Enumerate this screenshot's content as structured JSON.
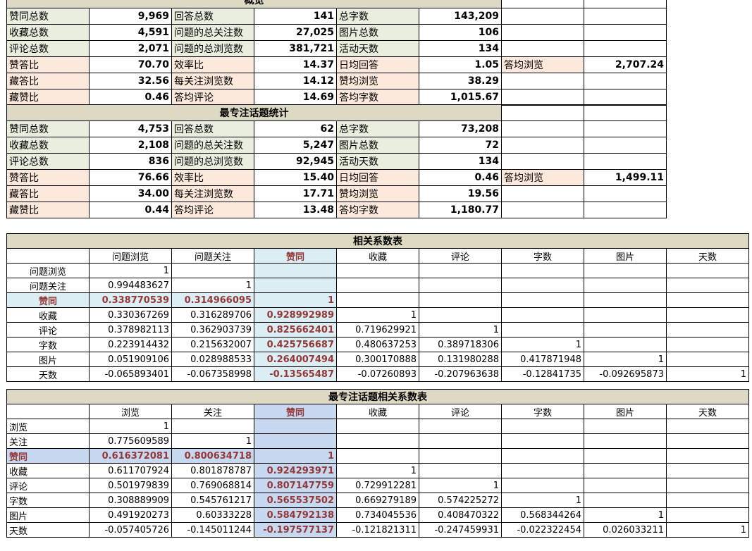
{
  "summary_overall": {
    "header": "概览",
    "rows": [
      {
        "c": [
          "green",
          "green",
          "green"
        ],
        "cells": [
          [
            "赞同总数",
            "9,969"
          ],
          [
            "回答总数",
            "141"
          ],
          [
            "总字数",
            "143,209"
          ]
        ]
      },
      {
        "c": [
          "green",
          "green",
          "green"
        ],
        "cells": [
          [
            "收藏总数",
            "4,591"
          ],
          [
            "问题的总关注数",
            "27,025"
          ],
          [
            "图片总数",
            "106"
          ]
        ]
      },
      {
        "c": [
          "green",
          "green",
          "green"
        ],
        "cells": [
          [
            "评论总数",
            "2,071"
          ],
          [
            "问题的总浏览数",
            "381,721"
          ],
          [
            "活动天数",
            "134"
          ]
        ]
      },
      {
        "c": [
          "pink",
          "pink",
          "pink"
        ],
        "cells": [
          [
            "赞答比",
            "70.70"
          ],
          [
            "效率比",
            "14.37"
          ],
          [
            "日均回答",
            "1.05"
          ]
        ],
        "extra": [
          "答均浏览",
          "2,707.24"
        ]
      },
      {
        "c": [
          "pink",
          "pink",
          "pink"
        ],
        "cells": [
          [
            "藏答比",
            "32.56"
          ],
          [
            "每关注浏览数",
            "14.12"
          ],
          [
            "赞均浏览",
            "38.29"
          ]
        ]
      },
      {
        "c": [
          "pink",
          "pink",
          "pink"
        ],
        "cells": [
          [
            "藏赞比",
            "0.46"
          ],
          [
            "答均评论",
            "14.69"
          ],
          [
            "答均字数",
            "1,015.67"
          ]
        ]
      }
    ]
  },
  "summary_focus": {
    "header": "最专注话题统计",
    "rows": [
      {
        "c": [
          "green",
          "green",
          "green"
        ],
        "cells": [
          [
            "赞同总数",
            "4,753"
          ],
          [
            "回答总数",
            "62"
          ],
          [
            "总字数",
            "73,208"
          ]
        ]
      },
      {
        "c": [
          "green",
          "green",
          "green"
        ],
        "cells": [
          [
            "收藏总数",
            "2,108"
          ],
          [
            "问题的总关注数",
            "5,247"
          ],
          [
            "图片总数",
            "72"
          ]
        ]
      },
      {
        "c": [
          "green",
          "green",
          "green"
        ],
        "cells": [
          [
            "评论总数",
            "836"
          ],
          [
            "问题的总浏览数",
            "92,945"
          ],
          [
            "活动天数",
            "134"
          ]
        ]
      },
      {
        "c": [
          "pink",
          "pink",
          "pink"
        ],
        "cells": [
          [
            "赞答比",
            "76.66"
          ],
          [
            "效率比",
            "15.40"
          ],
          [
            "日均回答",
            "0.46"
          ]
        ],
        "extra": [
          "答均浏览",
          "1,499.11"
        ]
      },
      {
        "c": [
          "pink",
          "pink",
          "pink"
        ],
        "cells": [
          [
            "藏答比",
            "34.00"
          ],
          [
            "每关注浏览数",
            "17.71"
          ],
          [
            "赞均浏览",
            "19.56"
          ]
        ]
      },
      {
        "c": [
          "pink",
          "pink",
          "pink"
        ],
        "cells": [
          [
            "藏赞比",
            "0.44"
          ],
          [
            "答均评论",
            "13.48"
          ],
          [
            "答均字数",
            "1,180.77"
          ]
        ]
      }
    ]
  },
  "corr_overall": {
    "title": "相关系数表",
    "columns": [
      "问题浏览",
      "问题关注",
      "赞同",
      "收藏",
      "评论",
      "字数",
      "图片",
      "天数"
    ],
    "rows": [
      {
        "label": "问题浏览",
        "values": [
          "1",
          "",
          "",
          "",
          "",
          "",
          "",
          ""
        ]
      },
      {
        "label": "问题关注",
        "values": [
          "0.994483627",
          "1",
          "",
          "",
          "",
          "",
          "",
          ""
        ]
      },
      {
        "label": "赞同",
        "values": [
          "0.338770539",
          "0.314966095",
          "1",
          "",
          "",
          "",
          "",
          ""
        ]
      },
      {
        "label": "收藏",
        "values": [
          "0.330367269",
          "0.316289706",
          "0.928992989",
          "1",
          "",
          "",
          "",
          ""
        ]
      },
      {
        "label": "评论",
        "values": [
          "0.378982113",
          "0.362903739",
          "0.825662401",
          "0.719629921",
          "1",
          "",
          "",
          ""
        ]
      },
      {
        "label": "字数",
        "values": [
          "0.223914432",
          "0.215632007",
          "0.425756687",
          "0.480637253",
          "0.389718306",
          "1",
          "",
          ""
        ]
      },
      {
        "label": "图片",
        "values": [
          "0.051909106",
          "0.028988533",
          "0.264007494",
          "0.300170888",
          "0.131980288",
          "0.417871948",
          "1",
          ""
        ]
      },
      {
        "label": "天数",
        "values": [
          "-0.065893401",
          "-0.067358998",
          "-0.13565487",
          "-0.07260893",
          "-0.207963638",
          "-0.12841735",
          "-0.092695873",
          "1"
        ]
      }
    ]
  },
  "corr_focus": {
    "title": "最专注话题相关系数表",
    "columns": [
      "浏览",
      "关注",
      "赞同",
      "收藏",
      "评论",
      "字数",
      "图片",
      "天数"
    ],
    "rows": [
      {
        "label": "浏览",
        "values": [
          "1",
          "",
          "",
          "",
          "",
          "",
          "",
          ""
        ]
      },
      {
        "label": "关注",
        "values": [
          "0.775609589",
          "1",
          "",
          "",
          "",
          "",
          "",
          ""
        ]
      },
      {
        "label": "赞同",
        "values": [
          "0.616372081",
          "0.800634718",
          "1",
          "",
          "",
          "",
          "",
          ""
        ]
      },
      {
        "label": "收藏",
        "values": [
          "0.611707924",
          "0.801878787",
          "0.924293971",
          "1",
          "",
          "",
          "",
          ""
        ]
      },
      {
        "label": "评论",
        "values": [
          "0.501979839",
          "0.769068814",
          "0.807147759",
          "0.729912281",
          "1",
          "",
          "",
          ""
        ]
      },
      {
        "label": "字数",
        "values": [
          "0.308889909",
          "0.545761217",
          "0.565537502",
          "0.669279189",
          "0.574225272",
          "1",
          "",
          ""
        ]
      },
      {
        "label": "图片",
        "values": [
          "0.491920273",
          "0.60333228",
          "0.584792138",
          "0.734045536",
          "0.408470322",
          "0.568344264",
          "1",
          ""
        ]
      },
      {
        "label": "天数",
        "values": [
          "-0.057405726",
          "-0.145011244",
          "-0.197577137",
          "-0.121821311",
          "-0.247459931",
          "-0.022322454",
          "0.026033211",
          "1"
        ]
      }
    ]
  },
  "colors": {
    "green": "#e9eedf",
    "pink": "#fce9dc",
    "title": "#ddd9c3",
    "highlight_blue": "#dbeef4",
    "highlight_blue2": "#c6d9f1",
    "accent_red": "#953735"
  }
}
